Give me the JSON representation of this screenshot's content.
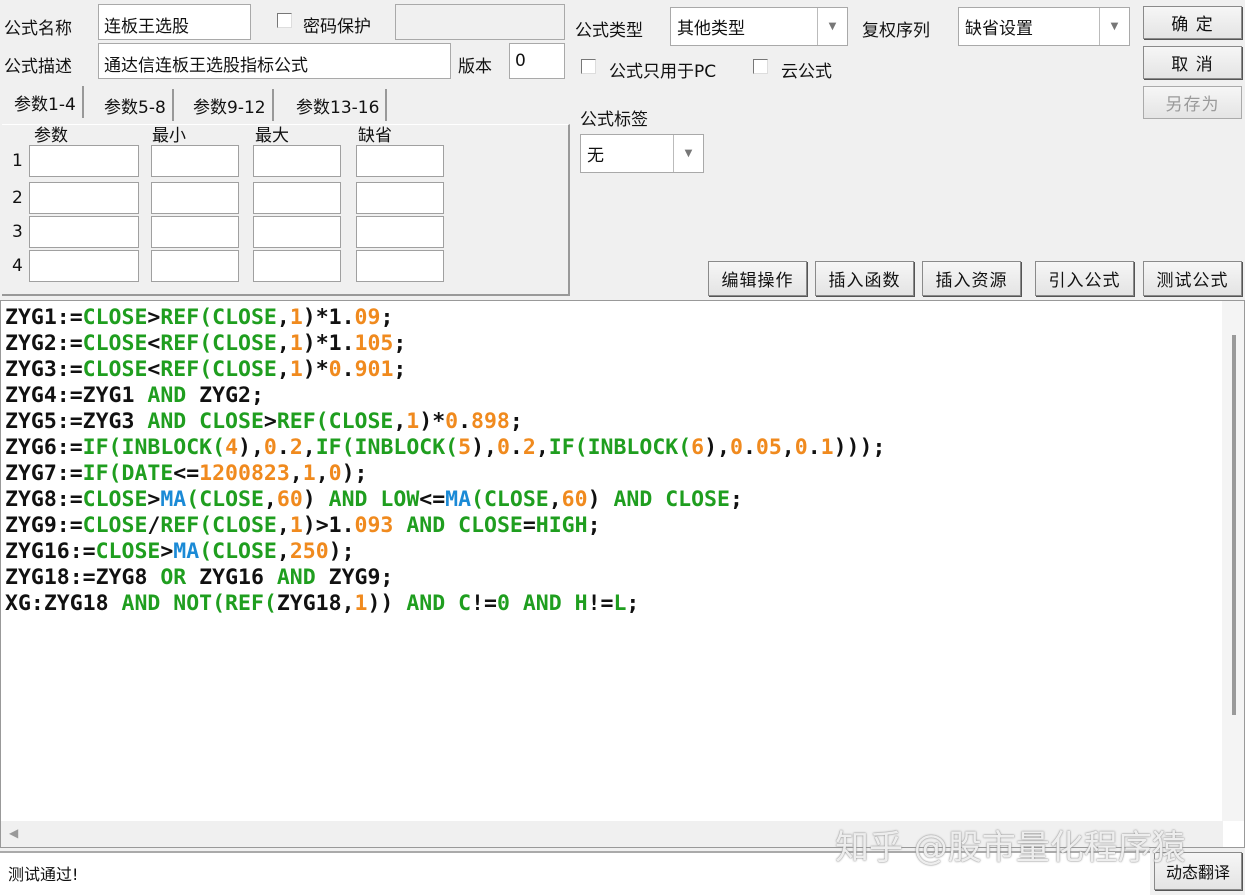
{
  "form": {
    "name_label": "公式名称",
    "name_value": "连板王选股",
    "password_label": "密码保护",
    "password_value": "",
    "desc_label": "公式描述",
    "desc_value": "通达信连板王选股指标公式",
    "version_label": "版本",
    "version_value": "0",
    "type_label": "公式类型",
    "type_value": "其他类型",
    "adjust_label": "复权序列",
    "adjust_value": "缺省设置",
    "pc_only_label": "公式只用于PC",
    "cloud_label": "云公式",
    "tag_label": "公式标签",
    "tag_value": "无"
  },
  "buttons": {
    "ok": "确 定",
    "cancel": "取 消",
    "save_as": "另存为",
    "edit_ops": "编辑操作",
    "insert_func": "插入函数",
    "insert_res": "插入资源",
    "import_formula": "引入公式",
    "test_formula": "测试公式",
    "dynamic_translate": "动态翻译"
  },
  "tabs": [
    "参数1-4",
    "参数5-8",
    "参数9-12",
    "参数13-16"
  ],
  "params": {
    "headers": [
      "参数",
      "最小",
      "最大",
      "缺省"
    ],
    "rows": [
      "1",
      "2",
      "3",
      "4"
    ]
  },
  "colors": {
    "function": "#1f9e1f",
    "number": "#f08a1e",
    "ma": "#1b8ad6",
    "text": "#111111"
  },
  "code_lines": [
    [
      [
        "t",
        "ZYG1:="
      ],
      [
        "f",
        "CLOSE"
      ],
      [
        "t",
        ">"
      ],
      [
        "f",
        "REF(CLOSE"
      ],
      [
        "t",
        ","
      ],
      [
        "n",
        "1"
      ],
      [
        "t",
        ")*1."
      ],
      [
        "n",
        "09"
      ],
      [
        "t",
        ";"
      ]
    ],
    [
      [
        "t",
        "ZYG2:="
      ],
      [
        "f",
        "CLOSE"
      ],
      [
        "t",
        "<"
      ],
      [
        "f",
        "REF(CLOSE"
      ],
      [
        "t",
        ","
      ],
      [
        "n",
        "1"
      ],
      [
        "t",
        ")*1."
      ],
      [
        "n",
        "105"
      ],
      [
        "t",
        ";"
      ]
    ],
    [
      [
        "t",
        "ZYG3:="
      ],
      [
        "f",
        "CLOSE"
      ],
      [
        "t",
        "<"
      ],
      [
        "f",
        "REF(CLOSE"
      ],
      [
        "t",
        ","
      ],
      [
        "n",
        "1"
      ],
      [
        "t",
        ")*"
      ],
      [
        "n",
        "0"
      ],
      [
        "t",
        "."
      ],
      [
        "n",
        "901"
      ],
      [
        "t",
        ";"
      ]
    ],
    [
      [
        "t",
        "ZYG4:=ZYG1 "
      ],
      [
        "f",
        "AND"
      ],
      [
        "t",
        " ZYG2;"
      ]
    ],
    [
      [
        "t",
        "ZYG5:=ZYG3 "
      ],
      [
        "f",
        "AND CLOSE"
      ],
      [
        "t",
        ">"
      ],
      [
        "f",
        "REF(CLOSE"
      ],
      [
        "t",
        ","
      ],
      [
        "n",
        "1"
      ],
      [
        "t",
        ")*"
      ],
      [
        "n",
        "0"
      ],
      [
        "t",
        "."
      ],
      [
        "n",
        "898"
      ],
      [
        "t",
        ";"
      ]
    ],
    [
      [
        "t",
        "ZYG6:="
      ],
      [
        "f",
        "IF(INBLOCK("
      ],
      [
        "n",
        "4"
      ],
      [
        "t",
        "),"
      ],
      [
        "n",
        "0"
      ],
      [
        "t",
        "."
      ],
      [
        "n",
        "2"
      ],
      [
        "t",
        ","
      ],
      [
        "f",
        "IF(INBLOCK("
      ],
      [
        "n",
        "5"
      ],
      [
        "t",
        "),"
      ],
      [
        "n",
        "0"
      ],
      [
        "t",
        "."
      ],
      [
        "n",
        "2"
      ],
      [
        "t",
        ","
      ],
      [
        "f",
        "IF(INBLOCK("
      ],
      [
        "n",
        "6"
      ],
      [
        "t",
        "),"
      ],
      [
        "n",
        "0"
      ],
      [
        "t",
        "."
      ],
      [
        "n",
        "05"
      ],
      [
        "t",
        ","
      ],
      [
        "n",
        "0"
      ],
      [
        "t",
        "."
      ],
      [
        "n",
        "1"
      ],
      [
        "t",
        ")));"
      ]
    ],
    [
      [
        "t",
        "ZYG7:="
      ],
      [
        "f",
        "IF(DATE"
      ],
      [
        "t",
        "<="
      ],
      [
        "n",
        "1200823"
      ],
      [
        "t",
        ","
      ],
      [
        "n",
        "1"
      ],
      [
        "t",
        ","
      ],
      [
        "n",
        "0"
      ],
      [
        "t",
        ");"
      ]
    ],
    [
      [
        "t",
        "ZYG8:="
      ],
      [
        "f",
        "CLOSE"
      ],
      [
        "t",
        ">"
      ],
      [
        "b",
        "MA"
      ],
      [
        "f",
        "(CLOSE"
      ],
      [
        "t",
        ","
      ],
      [
        "n",
        "60"
      ],
      [
        "t",
        ") "
      ],
      [
        "f",
        "AND LOW"
      ],
      [
        "t",
        "<="
      ],
      [
        "b",
        "MA"
      ],
      [
        "f",
        "(CLOSE"
      ],
      [
        "t",
        ","
      ],
      [
        "n",
        "60"
      ],
      [
        "t",
        ") "
      ],
      [
        "f",
        "AND CLOSE"
      ],
      [
        "t",
        ";"
      ]
    ],
    [
      [
        "t",
        "ZYG9:="
      ],
      [
        "f",
        "CLOSE"
      ],
      [
        "t",
        "/"
      ],
      [
        "f",
        "REF(CLOSE"
      ],
      [
        "t",
        ","
      ],
      [
        "n",
        "1"
      ],
      [
        "t",
        ")>1."
      ],
      [
        "n",
        "093"
      ],
      [
        "t",
        " "
      ],
      [
        "f",
        "AND CLOSE"
      ],
      [
        "t",
        "="
      ],
      [
        "f",
        "HIGH"
      ],
      [
        "t",
        ";"
      ]
    ],
    [
      [
        "t",
        "ZYG16:="
      ],
      [
        "f",
        "CLOSE"
      ],
      [
        "t",
        ">"
      ],
      [
        "b",
        "MA"
      ],
      [
        "f",
        "(CLOSE"
      ],
      [
        "t",
        ","
      ],
      [
        "n",
        "250"
      ],
      [
        "t",
        ");"
      ]
    ],
    [
      [
        "t",
        "ZYG18:=ZYG8 "
      ],
      [
        "f",
        "OR"
      ],
      [
        "t",
        " ZYG16 "
      ],
      [
        "f",
        "AND"
      ],
      [
        "t",
        " ZYG9;"
      ]
    ],
    [
      [
        "t",
        "XG:ZYG18 "
      ],
      [
        "f",
        "AND NOT(REF("
      ],
      [
        "t",
        "ZYG18,"
      ],
      [
        "n",
        "1"
      ],
      [
        "t",
        ")) "
      ],
      [
        "f",
        "AND C"
      ],
      [
        "t",
        "!="
      ],
      [
        "f",
        "0"
      ],
      [
        "t",
        " "
      ],
      [
        "f",
        "AND H"
      ],
      [
        "t",
        "!="
      ],
      [
        "f",
        "L"
      ],
      [
        "t",
        ";"
      ]
    ]
  ],
  "status_text": "测试通过!",
  "watermark": "知乎 @股市量化程序猿"
}
